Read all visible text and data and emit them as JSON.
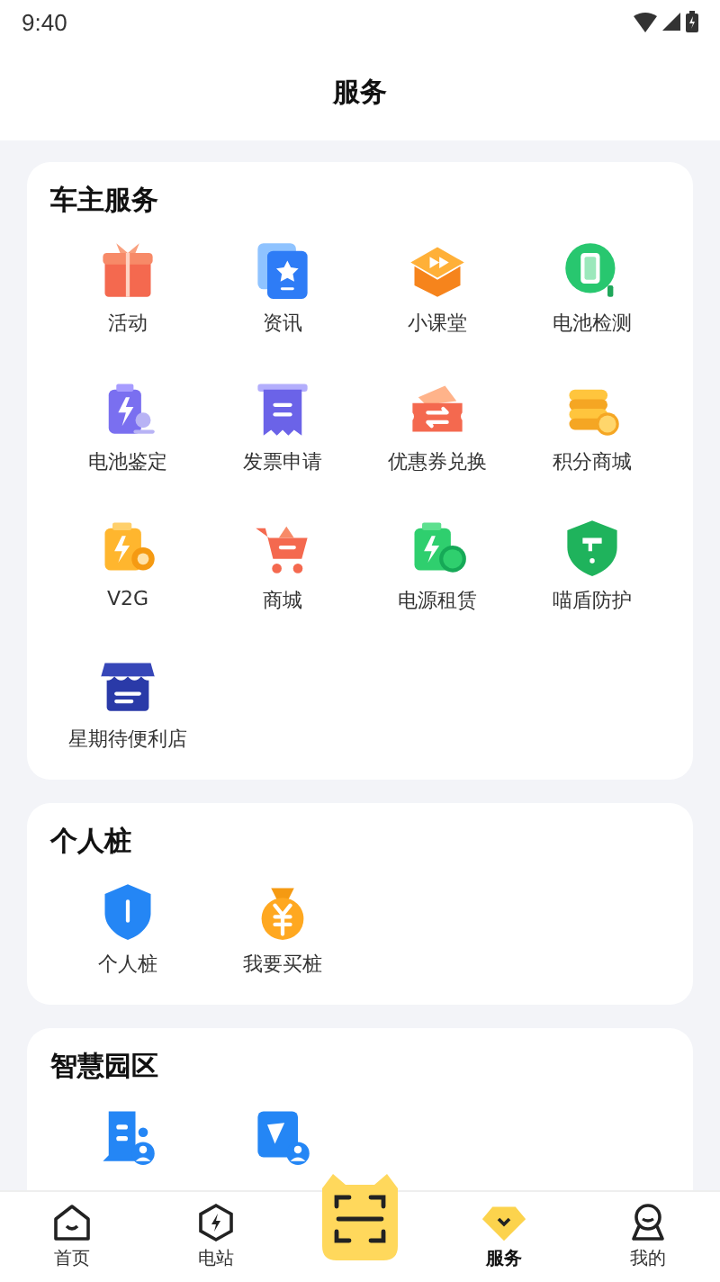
{
  "status_bar": {
    "time": "9:40"
  },
  "header": {
    "title": "服务"
  },
  "sections": [
    {
      "title": "车主服务",
      "items": [
        {
          "label": "活动"
        },
        {
          "label": "资讯"
        },
        {
          "label": "小课堂"
        },
        {
          "label": "电池检测"
        },
        {
          "label": "电池鉴定"
        },
        {
          "label": "发票申请"
        },
        {
          "label": "优惠券兑换"
        },
        {
          "label": "积分商城"
        },
        {
          "label": "V2G"
        },
        {
          "label": "商城"
        },
        {
          "label": "电源租赁"
        },
        {
          "label": "喵盾防护"
        },
        {
          "label": "星期待便利店"
        }
      ]
    },
    {
      "title": "个人桩",
      "items": [
        {
          "label": "个人桩"
        },
        {
          "label": "我要买桩"
        }
      ]
    },
    {
      "title": "智慧园区",
      "items": [
        {
          "kind": "icon"
        },
        {
          "kind": "icon"
        }
      ]
    }
  ],
  "tab_bar": [
    {
      "kind": "tab",
      "label": "首页",
      "selected": false
    },
    {
      "kind": "tab",
      "label": "电站",
      "selected": false
    },
    {
      "kind": "scan"
    },
    {
      "kind": "tab",
      "label": "服务",
      "selected": true
    },
    {
      "kind": "tab",
      "label": "我的",
      "selected": false
    }
  ]
}
